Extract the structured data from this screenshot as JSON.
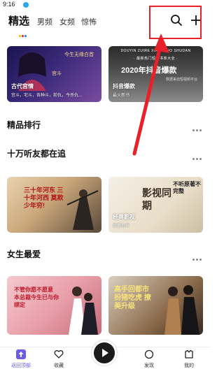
{
  "status_bar": {
    "time": "9:16"
  },
  "header": {
    "tabs": [
      {
        "label": "精选",
        "active": true
      },
      {
        "label": "男频",
        "active": false
      },
      {
        "label": "女频",
        "active": false
      },
      {
        "label": "惊怖",
        "active": false
      }
    ]
  },
  "cards_top": [
    {
      "title": "古代宫情",
      "subtitle": "宫斗，宅斗，各种斗，前仇，今杀仇...",
      "art_text": "今生无缘白首",
      "tag": "宫斗"
    },
    {
      "title": "抖音爆款",
      "subtitle": "最火新书",
      "banner": "2020年抖音爆款",
      "top_label": "DOUYIN ZUIRE XIAOSHUO SHUDAN",
      "note": "· 最新热门短篇书单大全 ·",
      "small_label": "数据来自短视频平台"
    }
  ],
  "sections": [
    {
      "title": "精品排行"
    },
    {
      "title": "十万听友都在追"
    },
    {
      "title": "女生最爱"
    }
  ],
  "cards_middle": [
    {
      "art_text": "三十年河东 三十年河西 莫欺少年穷!"
    },
    {
      "title": "经典影视",
      "subtitle": "原著有声",
      "art_text": "影视同期",
      "corner_text": "不听原著不完整"
    }
  ],
  "cards_bottom": [
    {
      "art_text": "不管你愿不愿意 本总裁今生已与你绑定"
    },
    {
      "art_text": "高手回都市 扮猪吃虎 撩美升级"
    }
  ],
  "bottom_nav": [
    {
      "label": "返回顶部",
      "icon": "arrow-up-icon",
      "active": true
    },
    {
      "label": "收藏",
      "icon": "heart-icon",
      "active": false
    },
    {
      "label": "发现",
      "icon": "circle-icon",
      "active": false
    },
    {
      "label": "我的",
      "icon": "profile-icon",
      "active": false
    }
  ],
  "colors": {
    "accent": "#6b5ce7",
    "highlight": "#e8202a"
  }
}
